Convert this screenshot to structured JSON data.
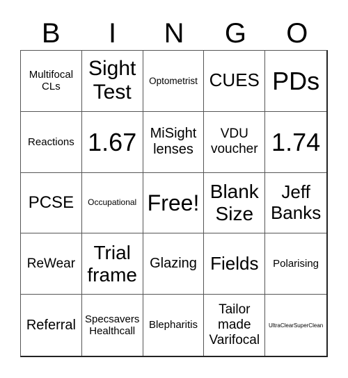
{
  "header": [
    "B",
    "I",
    "N",
    "G",
    "O"
  ],
  "cells": [
    "Multifocal CLs",
    "Sight Test",
    "Optometrist",
    "CUES",
    "PDs",
    "Reactions",
    "1.67",
    "MiSight lenses",
    "VDU voucher",
    "1.74",
    "PCSE",
    "Occupational",
    "Free!",
    "Blank Size",
    "Jeff Banks",
    "ReWear",
    "Trial frame",
    "Glazing",
    "Fields",
    "Polarising",
    "Referral",
    "Specsavers Healthcall",
    "Blepharitis",
    "Tailor made Varifocal",
    "UltraClearSuperClean"
  ]
}
